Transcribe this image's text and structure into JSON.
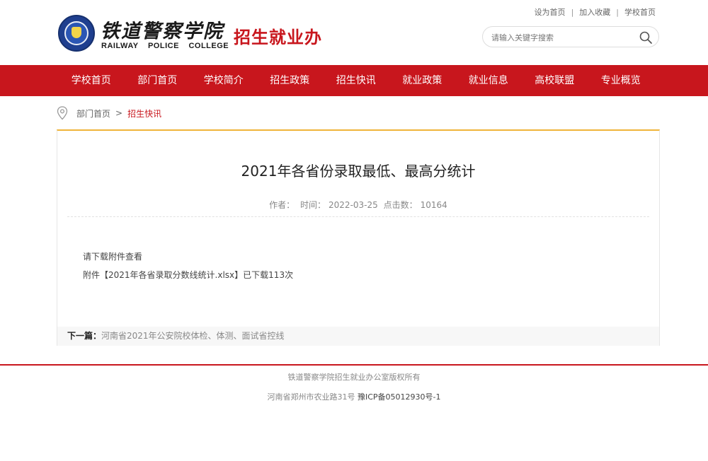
{
  "header": {
    "logo_cn": "铁道警察学院",
    "logo_en": "RAILWAY POLICE COLLEGE",
    "office_title": "招生就业办",
    "top_links": [
      "设为首页",
      "加入收藏",
      "学校首页"
    ],
    "search": {
      "placeholder": "请输入关键字搜索",
      "icon": "search-icon"
    }
  },
  "nav": {
    "items": [
      "学校首页",
      "部门首页",
      "学校简介",
      "招生政策",
      "招生快讯",
      "就业政策",
      "就业信息",
      "高校联盟",
      "专业概览"
    ]
  },
  "breadcrumb": {
    "icon": "location-pin-icon",
    "home": "部门首页",
    "arrow": ">",
    "current": "招生快讯"
  },
  "article": {
    "title": "2021年各省份录取最低、最高分统计",
    "author_label": "作者：",
    "time_label": "时间：",
    "time": "2022-03-25",
    "hits_label": "点击数：",
    "hits": "10164",
    "body_line1": "请下载附件查看",
    "attachment_prefix": "附件【",
    "attachment_name": "2021年各省录取分数线统计.xlsx",
    "attachment_suffix": "】已下载113次",
    "next_label": "下一篇：",
    "next_title": "河南省2021年公安院校体检、体测、面试省控线"
  },
  "footer": {
    "copyright": "铁道警察学院招生就业办公室版权所有",
    "address": "河南省郑州市农业路31号",
    "icp": "豫ICP备05012930号-1"
  },
  "colors": {
    "brand_red": "#c8161d",
    "accent_gold": "#f0b43a"
  }
}
